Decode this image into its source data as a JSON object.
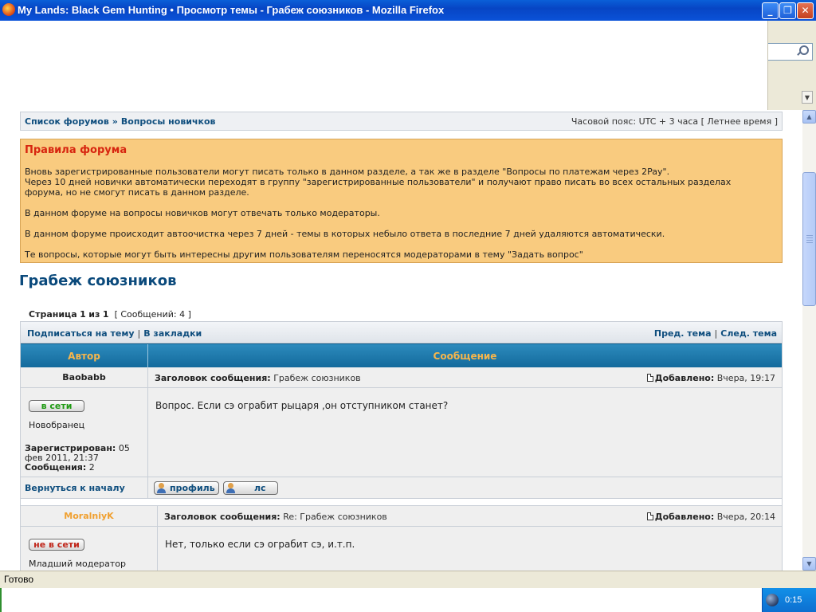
{
  "window": {
    "title": "My Lands: Black Gem Hunting • Просмотр темы - Грабеж союзников - Mozilla Firefox",
    "minimize_glyph": "_",
    "maximize_glyph": "❐",
    "close_glyph": "✕"
  },
  "nav": {
    "crumbs": [
      "Список форумов",
      "Вопросы новичков"
    ],
    "crumb_sep": "»",
    "timezone": "Часовой пояс: UTC + 3 часа [ Летнее время ]"
  },
  "rules": {
    "heading": "Правила форума",
    "p1": "Вновь зарегистрированные пользователи могут писать только в данном разделе, а так же в разделе \"Вопросы по платежам через 2Pay\".",
    "p2": "Через 10 дней новички автоматически переходят в группу \"зарегистрированные пользователи\" и получают право писать во всех остальных разделах",
    "p3": "форума, но не смогут писать в данном разделе.",
    "p4": "В данном форуме на вопросы новичков могут отвечать только модераторы.",
    "p5": "В данном форуме происходит автоочистка через 7 дней - темы в которых небыло ответа в последние 7 дней удаляются автоматически.",
    "p6": "Те вопросы, которые могут быть интересны другим пользователям переносятся модераторами в тему \"Задать вопрос\""
  },
  "topic": {
    "title": "Грабеж союзников",
    "page_label": "Страница",
    "page_current": "1",
    "page_of": "из",
    "page_total": "1",
    "messages_count": "[ Сообщений: 4 ]"
  },
  "actions": {
    "subscribe": "Подписаться на тему",
    "bookmark": "В закладки",
    "prev": "Пред. тема",
    "next": "След. тема",
    "pipe": "|"
  },
  "table": {
    "col_author": "Автор",
    "col_message": "Сообщение"
  },
  "posts": [
    {
      "author": "Baobabb",
      "author_color": "#222222",
      "subject_label": "Заголовок сообщения:",
      "subject": "Грабеж союзников",
      "posted_label": "Добавлено:",
      "posted": "Вчера, 19:17",
      "status": "в сети",
      "rank": "Новобранец",
      "registered_label": "Зарегистрирован:",
      "registered": "05 фев 2011, 21:37",
      "posts_label": "Сообщения:",
      "posts_count": "2",
      "body": "Вопрос. Если сэ ограбит рыцаря ,он отступником станет?",
      "back_to_top": "Вернуться к началу",
      "profile_btn": "профиль",
      "pm_btn": "лс"
    },
    {
      "author": "MoralniyK",
      "author_color": "#f0a030",
      "subject_label": "Заголовок сообщения:",
      "subject": "Re: Грабеж союзников",
      "posted_label": "Добавлено:",
      "posted": "Вчера, 20:14",
      "status": "не в сети",
      "rank": "Младший модератор",
      "body": "Нет, только если сэ ограбит сэ, и.т.п."
    }
  ],
  "statusbar": {
    "text": "Готово"
  },
  "tray": {
    "clock": "0:15"
  },
  "colors": {
    "link": "#0f4e7e",
    "rules_bg": "#f9cb7f",
    "rules_heading": "#d7250f",
    "header_bg": "#136a9c",
    "header_text": "#f7b64c",
    "online": "#1e9a12",
    "offline": "#c1271b"
  }
}
